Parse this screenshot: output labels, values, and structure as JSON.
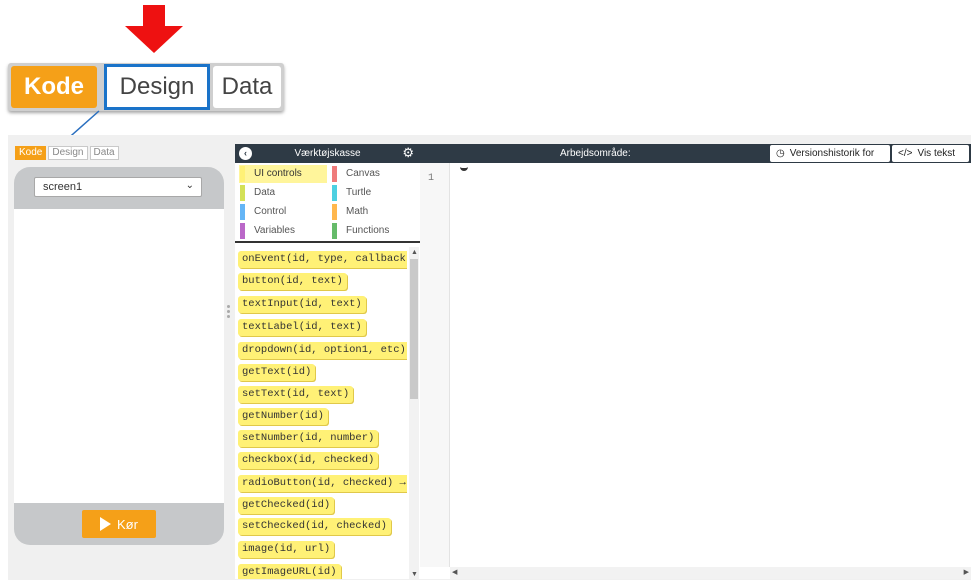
{
  "callout": {
    "tabs": {
      "kode": "Kode",
      "design": "Design",
      "data": "Data"
    },
    "arrow_color": "#ee1111",
    "highlight_color": "#1a73c9"
  },
  "left_panel": {
    "tabs": {
      "kode": "Kode",
      "design": "Design",
      "data": "Data"
    },
    "screen_select_value": "screen1",
    "run_button_label": "Kør"
  },
  "toolbox": {
    "title": "Værktøjskasse",
    "categories": [
      {
        "label": "UI controls",
        "color": "#fff176",
        "active": true
      },
      {
        "label": "Canvas",
        "color": "#ef7b7b"
      },
      {
        "label": "Data",
        "color": "#d4e157"
      },
      {
        "label": "Turtle",
        "color": "#4dd0e1"
      },
      {
        "label": "Control",
        "color": "#64b5f6"
      },
      {
        "label": "Math",
        "color": "#ffb74d"
      },
      {
        "label": "Variables",
        "color": "#ba68c8"
      },
      {
        "label": "Functions",
        "color": "#66bb6a"
      }
    ],
    "blocks": [
      "onEvent(id, type, callback",
      "button(id, text)",
      "textInput(id, text)",
      "textLabel(id, text)",
      "dropdown(id, option1, etc)",
      "getText(id)",
      "setText(id, text)",
      "getNumber(id)",
      "setNumber(id, number)",
      "checkbox(id, checked)",
      "radioButton(id, checked) →",
      "getChecked(id)",
      "setChecked(id, checked)",
      "image(id, url)",
      "getImageURL(id)"
    ]
  },
  "workspace": {
    "title": "Arbejdsområde:",
    "version_history_label": "Versionshistorik for",
    "show_text_label": "Vis tekst",
    "line_numbers": [
      "1"
    ]
  },
  "colors": {
    "accent": "#f5a018",
    "header": "#2e3a45",
    "block": "#fff176"
  }
}
